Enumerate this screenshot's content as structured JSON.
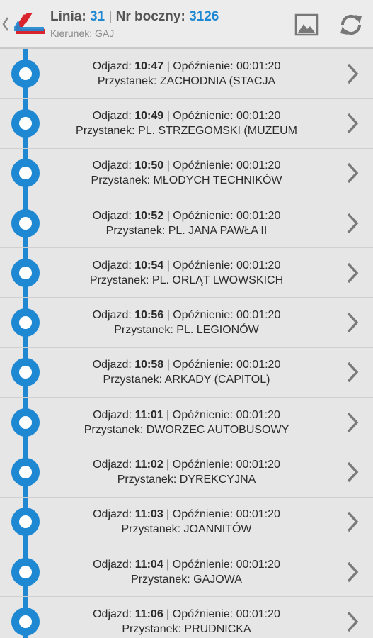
{
  "header": {
    "line_label": "Linia:",
    "line_value": "31",
    "separator": "|",
    "vehicle_label": "Nr boczny:",
    "vehicle_value": "3126",
    "direction": "Kierunek: GAJ",
    "icons": [
      "back-chevron-icon",
      "app-logo",
      "image-icon",
      "refresh-icon"
    ],
    "accent_color": "#1e88d2"
  },
  "stops": [
    {
      "depart_label": "Odjazd:",
      "time": "10:47",
      "delay_text": " | Opóźnienie: 00:01:20",
      "stop_text": "Przystanek: ZACHODNIA (STACJA"
    },
    {
      "depart_label": "Odjazd:",
      "time": "10:49",
      "delay_text": " | Opóźnienie: 00:01:20",
      "stop_text": "Przystanek: PL. STRZEGOMSKI (MUZEUM"
    },
    {
      "depart_label": "Odjazd:",
      "time": "10:50",
      "delay_text": " | Opóźnienie: 00:01:20",
      "stop_text": "Przystanek: MŁODYCH TECHNIKÓW"
    },
    {
      "depart_label": "Odjazd:",
      "time": "10:52",
      "delay_text": " | Opóźnienie: 00:01:20",
      "stop_text": "Przystanek: PL. JANA PAWŁA II"
    },
    {
      "depart_label": "Odjazd:",
      "time": "10:54",
      "delay_text": " | Opóźnienie: 00:01:20",
      "stop_text": "Przystanek: PL. ORLĄT LWOWSKICH"
    },
    {
      "depart_label": "Odjazd:",
      "time": "10:56",
      "delay_text": " | Opóźnienie: 00:01:20",
      "stop_text": "Przystanek: PL. LEGIONÓW"
    },
    {
      "depart_label": "Odjazd:",
      "time": "10:58",
      "delay_text": " | Opóźnienie: 00:01:20",
      "stop_text": "Przystanek: ARKADY (CAPITOL)"
    },
    {
      "depart_label": "Odjazd:",
      "time": "11:01",
      "delay_text": " | Opóźnienie: 00:01:20",
      "stop_text": "Przystanek: DWORZEC AUTOBUSOWY"
    },
    {
      "depart_label": "Odjazd:",
      "time": "11:02",
      "delay_text": " | Opóźnienie: 00:01:20",
      "stop_text": "Przystanek: DYREKCYJNA"
    },
    {
      "depart_label": "Odjazd:",
      "time": "11:03",
      "delay_text": " | Opóźnienie: 00:01:20",
      "stop_text": "Przystanek: JOANNITÓW"
    },
    {
      "depart_label": "Odjazd:",
      "time": "11:04",
      "delay_text": " | Opóźnienie: 00:01:20",
      "stop_text": "Przystanek: GAJOWA"
    },
    {
      "depart_label": "Odjazd:",
      "time": "11:06",
      "delay_text": " | Opóźnienie: 00:01:20",
      "stop_text": "Przystanek: PRUDNICKA"
    }
  ]
}
